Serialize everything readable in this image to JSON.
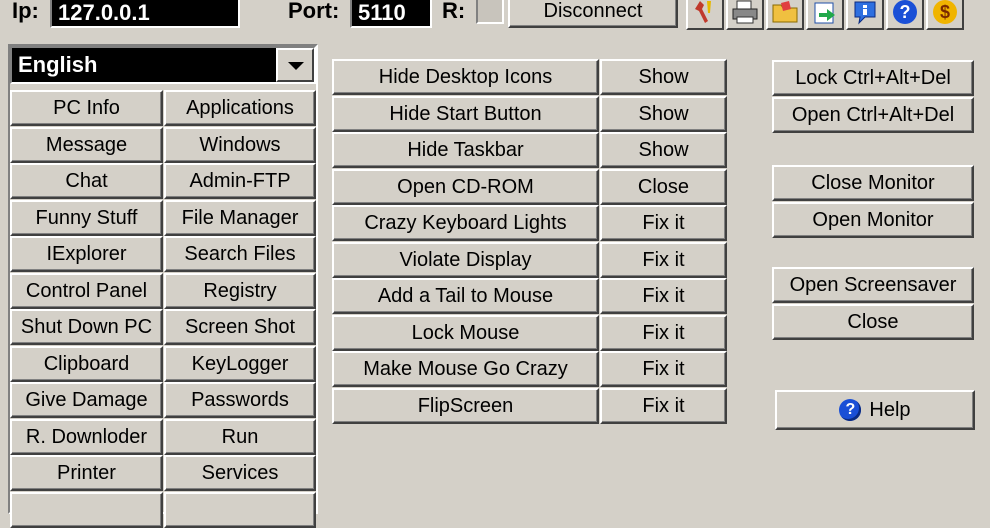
{
  "topbar": {
    "ip_label": "Ip:",
    "ip_value": "127.0.0.1",
    "port_label": "Port:",
    "port_value": "5110",
    "r_label": "R:",
    "disconnect_label": "Disconnect",
    "tools": [
      "wrench-icon",
      "printer-icon",
      "folder-icon",
      "export-icon",
      "info-icon",
      "help-icon",
      "money-icon"
    ],
    "help_glyph": "?",
    "money_glyph": "$"
  },
  "language": {
    "selected": "English"
  },
  "left_buttons": [
    [
      "PC Info",
      "Applications"
    ],
    [
      "Message",
      "Windows"
    ],
    [
      "Chat",
      "Admin-FTP"
    ],
    [
      "Funny Stuff",
      "File Manager"
    ],
    [
      "IExplorer",
      "Search Files"
    ],
    [
      "Control Panel",
      "Registry"
    ],
    [
      "Shut Down PC",
      "Screen Shot"
    ],
    [
      "Clipboard",
      "KeyLogger"
    ],
    [
      "Give Damage",
      "Passwords"
    ],
    [
      "R. Downloder",
      "Run"
    ],
    [
      "Printer",
      "Services"
    ]
  ],
  "actions": [
    {
      "label": "Hide Desktop Icons",
      "undo": "Show"
    },
    {
      "label": "Hide Start Button",
      "undo": "Show"
    },
    {
      "label": "Hide Taskbar",
      "undo": "Show"
    },
    {
      "label": "Open CD-ROM",
      "undo": "Close"
    },
    {
      "label": "Crazy Keyboard Lights",
      "undo": "Fix it"
    },
    {
      "label": "Violate Display",
      "undo": "Fix it"
    },
    {
      "label": "Add a Tail to Mouse",
      "undo": "Fix it"
    },
    {
      "label": "Lock Mouse",
      "undo": "Fix it"
    },
    {
      "label": "Make Mouse Go Crazy",
      "undo": "Fix it"
    },
    {
      "label": "FlipScreen",
      "undo": "Fix it"
    }
  ],
  "right": {
    "lock_cad": "Lock Ctrl+Alt+Del",
    "open_cad": "Open Ctrl+Alt+Del",
    "close_monitor": "Close Monitor",
    "open_monitor": "Open Monitor",
    "open_screensaver": "Open Screensaver",
    "close_screensaver": "Close",
    "help": "Help",
    "help_glyph": "?"
  }
}
